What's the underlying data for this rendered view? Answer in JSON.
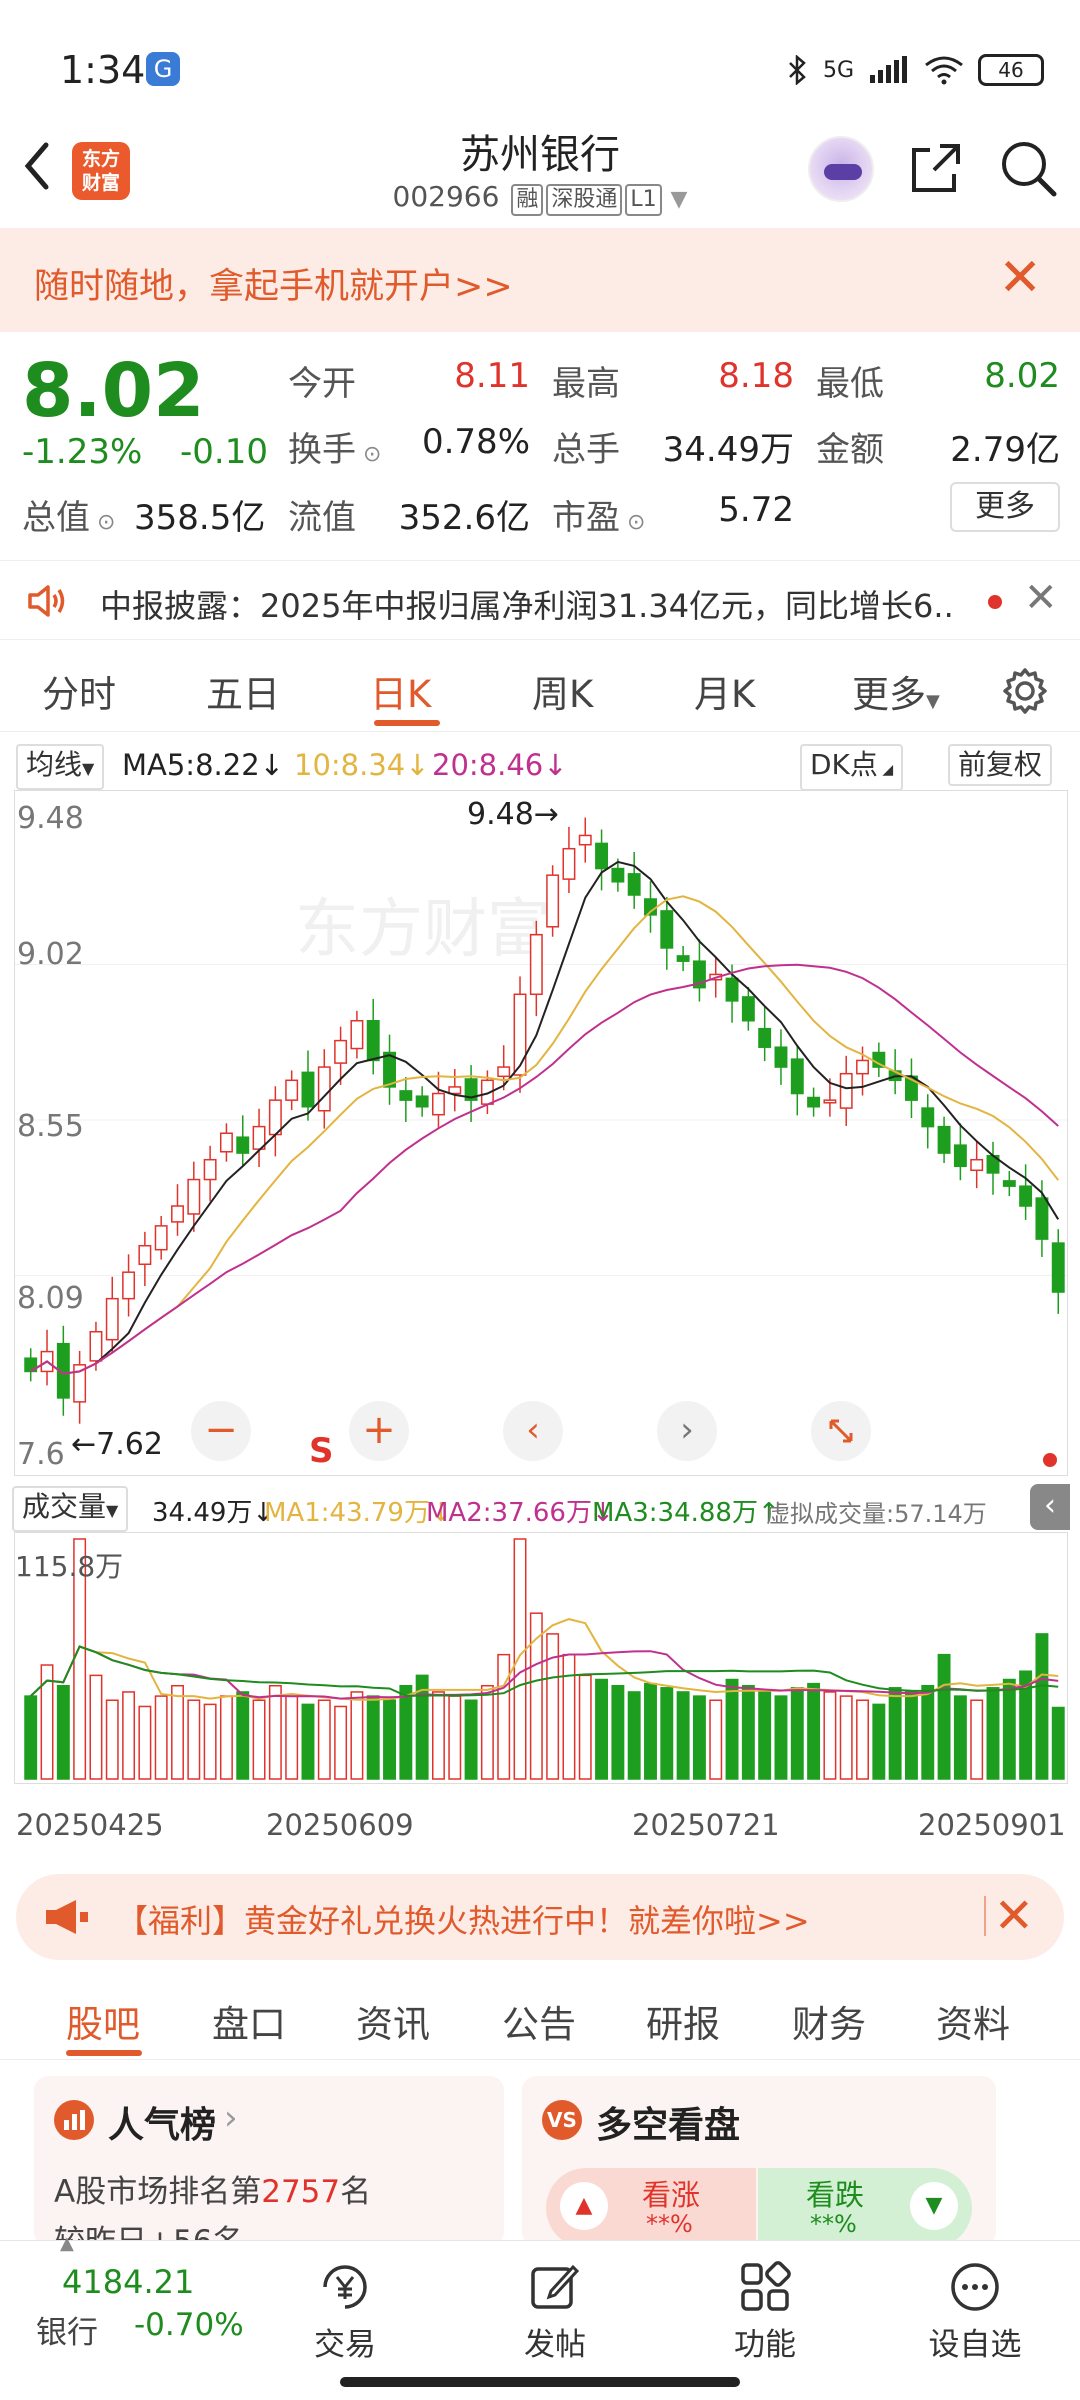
{
  "status_bar": {
    "time": "1:34",
    "network": "5G",
    "battery": "46"
  },
  "header": {
    "app_logo": "东方\n财富",
    "stock_name": "苏州银行",
    "stock_code": "002966",
    "tags": [
      "融",
      "深股通",
      "L1"
    ]
  },
  "promo": {
    "text": "随时随地，拿起手机就开户>>"
  },
  "quote": {
    "price": "8.02",
    "change_pct": "-1.23%",
    "change_amt": "-0.10",
    "market_cap_label": "总值",
    "market_cap": "358.5亿",
    "fields": [
      {
        "label": "今开",
        "value": "8.11",
        "color": "#e0332b"
      },
      {
        "label": "最高",
        "value": "8.18",
        "color": "#e0332b"
      },
      {
        "label": "最低",
        "value": "8.02",
        "color": "#1e8c1e"
      },
      {
        "label": "换手",
        "value": "0.78%",
        "color": "#222222"
      },
      {
        "label": "总手",
        "value": "34.49万",
        "color": "#222222"
      },
      {
        "label": "金额",
        "value": "2.79亿",
        "color": "#222222"
      },
      {
        "label": "流值",
        "value": "352.6亿",
        "color": "#222222"
      },
      {
        "label": "市盈",
        "value": "5.72",
        "color": "#222222"
      }
    ],
    "more_label": "更多"
  },
  "notice": {
    "text": "中报披露：2025年中报归属净利润31.34亿元，同比增长6.."
  },
  "period_tabs": [
    "分时",
    "五日",
    "日K",
    "周K",
    "月K",
    "更多"
  ],
  "active_period": "日K",
  "ma_bar": {
    "ma_selector": "均线",
    "ma5": "MA5:8.22",
    "ma10": "10:8.34",
    "ma20": "20:8.46",
    "dk_label": "DK点",
    "adjust_label": "前复权"
  },
  "kchart": {
    "y_ticks": [
      "9.48",
      "9.02",
      "8.55",
      "8.09",
      "7.6"
    ],
    "high_label": "9.48",
    "low_label": "7.62",
    "signal": "S"
  },
  "volume_bar": {
    "selector": "成交量",
    "current": "34.49万",
    "ma1": "MA1:43.79万",
    "ma2": "MA2:37.66万",
    "ma3": "MA3:34.88万",
    "virtual": "虚拟成交量:57.14万",
    "max_label": "115.8万"
  },
  "dates": [
    "20250425",
    "20250609",
    "20250721",
    "20250901"
  ],
  "welfare": {
    "text": "【福利】黄金好礼兑换火热进行中！就差你啦>>"
  },
  "sub_tabs": [
    "股吧",
    "盘口",
    "资讯",
    "公告",
    "研报",
    "财务",
    "资料"
  ],
  "cards": {
    "popularity": {
      "title": "人气榜",
      "line1_prefix": "A股市场排名第",
      "rank": "2757",
      "line1_suffix": "名",
      "line2": "较昨日+56名"
    },
    "sentiment": {
      "title": "多空看盘",
      "up_label": "看涨",
      "up_value": "**%",
      "down_label": "看跌",
      "down_value": "**%"
    }
  },
  "bottom_nav": {
    "index_value": "4184.21",
    "index_name": "银行",
    "index_change": "-0.70%",
    "items": [
      "交易",
      "发帖",
      "功能",
      "设自选"
    ]
  },
  "chart_data": {
    "type": "candlestick",
    "ylim": [
      7.6,
      9.48
    ],
    "high": 9.48,
    "low": 7.62,
    "close": [
      7.78,
      7.84,
      7.7,
      7.8,
      7.9,
      8.0,
      8.08,
      8.16,
      8.22,
      8.28,
      8.36,
      8.42,
      8.5,
      8.44,
      8.52,
      8.6,
      8.66,
      8.58,
      8.7,
      8.78,
      8.84,
      8.72,
      8.64,
      8.6,
      8.58,
      8.62,
      8.64,
      8.6,
      8.66,
      8.7,
      8.92,
      9.1,
      9.28,
      9.36,
      9.4,
      9.3,
      9.26,
      9.22,
      9.16,
      9.06,
      9.02,
      8.94,
      8.98,
      8.9,
      8.84,
      8.76,
      8.7,
      8.62,
      8.58,
      8.6,
      8.68,
      8.72,
      8.7,
      8.66,
      8.6,
      8.52,
      8.44,
      8.4,
      8.42,
      8.38,
      8.34,
      8.28,
      8.18,
      8.02
    ],
    "volume": [
      40,
      55,
      45,
      115.8,
      50,
      38,
      42,
      35,
      40,
      45,
      38,
      36,
      40,
      42,
      38,
      45,
      40,
      36,
      38,
      35,
      42,
      40,
      38,
      45,
      50,
      42,
      40,
      38,
      45,
      60,
      115.8,
      80,
      70,
      60,
      50,
      48,
      45,
      42,
      46,
      44,
      42,
      40,
      38,
      48,
      45,
      42,
      40,
      44,
      46,
      42,
      40,
      38,
      36,
      44,
      42,
      45,
      60,
      40,
      38,
      44,
      48,
      52,
      70,
      34.49
    ]
  }
}
